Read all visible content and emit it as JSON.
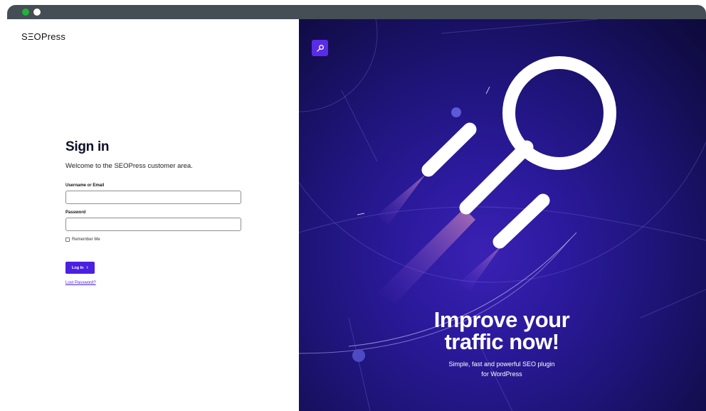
{
  "window": {
    "controls": [
      "green-dot",
      "white-dot"
    ]
  },
  "brand": {
    "logo_text": "SΞOPress",
    "accent_color": "#4a21e0"
  },
  "form": {
    "title": "Sign in",
    "welcome": "Welcome to the SEOPress customer area.",
    "username_label": "Username or Email",
    "username_value": "",
    "password_label": "Password",
    "password_value": "",
    "remember_label": "Remember Me",
    "remember_checked": false,
    "login_label": "Log In",
    "login_icon": "chevron-right-icon",
    "lost_password": "Lost Password?"
  },
  "promo": {
    "badge_icon": "magnifier-icon",
    "headline_line1": "Improve your",
    "headline_line2": "traffic now!",
    "sub_line1": "Simple, fast and powerful SEO plugin",
    "sub_line2": "for WordPress",
    "background_color": "#1e1478"
  }
}
